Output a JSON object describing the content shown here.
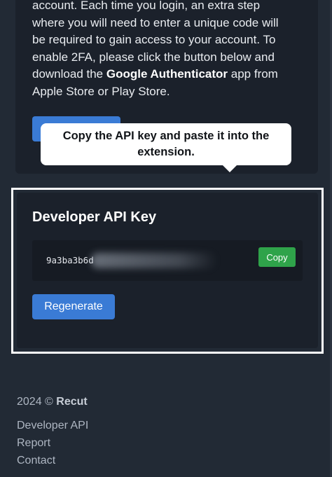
{
  "twofa": {
    "line1": "account. Each time you login, an extra step",
    "line2": "where you will need to enter a unique code will",
    "line3": "be required to gain access to your account. To",
    "line4": "enable 2FA, please click the button below and",
    "line5_pre": "download the ",
    "line5_bold": "Google Authenticator",
    "line5_post": " app from",
    "line6": "Apple Store or Play Store."
  },
  "tooltip": {
    "line1": "Copy the API key and paste it into the",
    "line2": "extension."
  },
  "api": {
    "title": "Developer API Key",
    "key_visible": "9a3ba3b6d",
    "copy_label": "Copy",
    "regenerate_label": "Regenerate"
  },
  "footer": {
    "year": "2024 ©",
    "brand": "Recut",
    "links": [
      "Developer API",
      "Report",
      "Contact"
    ]
  },
  "colors": {
    "background": "#222a35",
    "card": "#1b212b",
    "primary_button": "#3a7bd5",
    "copy_button": "#2fa34a"
  }
}
